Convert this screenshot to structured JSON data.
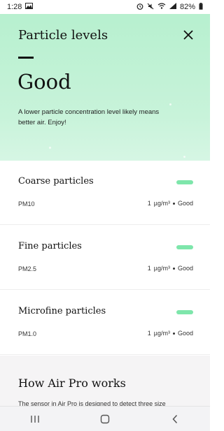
{
  "status_bar": {
    "time": "1:28",
    "battery": "82%",
    "icons": [
      "image-icon",
      "alarm-icon",
      "mute-icon",
      "wifi-icon",
      "signal-icon",
      "battery-icon"
    ]
  },
  "header": {
    "title": "Particle levels",
    "close_icon": "close-icon",
    "status": "Good",
    "description": "A lower particle concentration level likely means better air. Enjoy!",
    "accent": "#b7f0cf"
  },
  "cards": [
    {
      "title": "Coarse particles",
      "code": "PM10",
      "value": "1",
      "unit": "µg/m³",
      "rating": "Good",
      "indicator_color": "#7ee6ab"
    },
    {
      "title": "Fine particles",
      "code": "PM2.5",
      "value": "1",
      "unit": "µg/m³",
      "rating": "Good",
      "indicator_color": "#7ee6ab"
    },
    {
      "title": "Microfine particles",
      "code": "PM1.0",
      "value": "1",
      "unit": "µg/m³",
      "rating": "Good",
      "indicator_color": "#7ee6ab"
    }
  ],
  "info": {
    "title": "How Air Pro works",
    "text": "The sensor in Air Pro is designed to detect three size"
  },
  "nav_bar": {
    "icons": [
      "recent-apps-icon",
      "home-icon",
      "back-icon"
    ]
  }
}
